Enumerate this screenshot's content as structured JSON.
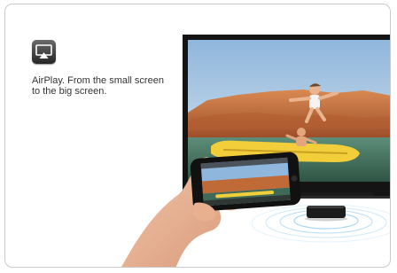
{
  "feature": {
    "icon": "airplay-icon",
    "caption_lines": [
      "AirPlay. From the small screen",
      "to the big screen."
    ]
  },
  "colors": {
    "tv_frame": "#141414",
    "sky": "#9fc1df",
    "rock": "#c06a38",
    "raft": "#f2cf3a",
    "apple_tv": "#1c1c1c",
    "wave": "#9fd3ee"
  }
}
